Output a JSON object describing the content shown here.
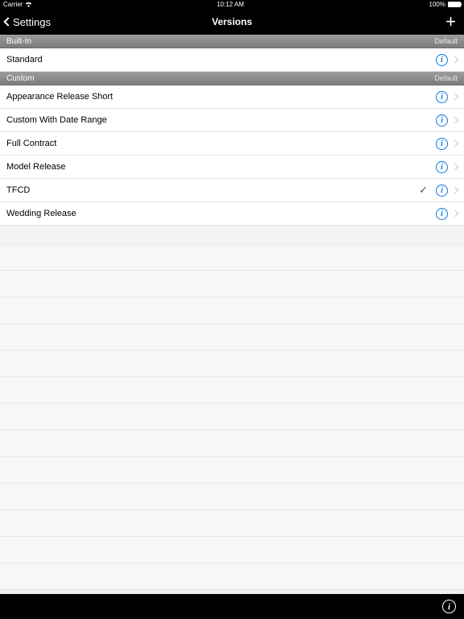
{
  "statusBar": {
    "carrier": "Carrier",
    "time": "10:12 AM",
    "battery": "100%"
  },
  "nav": {
    "back": "Settings",
    "title": "Versions"
  },
  "sections": [
    {
      "title": "Built-In",
      "right": "Default",
      "items": [
        {
          "label": "Standard",
          "checked": false
        }
      ]
    },
    {
      "title": "Custom",
      "right": "Default",
      "items": [
        {
          "label": "Appearance Release Short",
          "checked": false
        },
        {
          "label": "Custom With Date Range",
          "checked": false
        },
        {
          "label": "Full Contract",
          "checked": false
        },
        {
          "label": "Model Release",
          "checked": false
        },
        {
          "label": "TFCD",
          "checked": true
        },
        {
          "label": "Wedding Release",
          "checked": false
        }
      ]
    }
  ]
}
